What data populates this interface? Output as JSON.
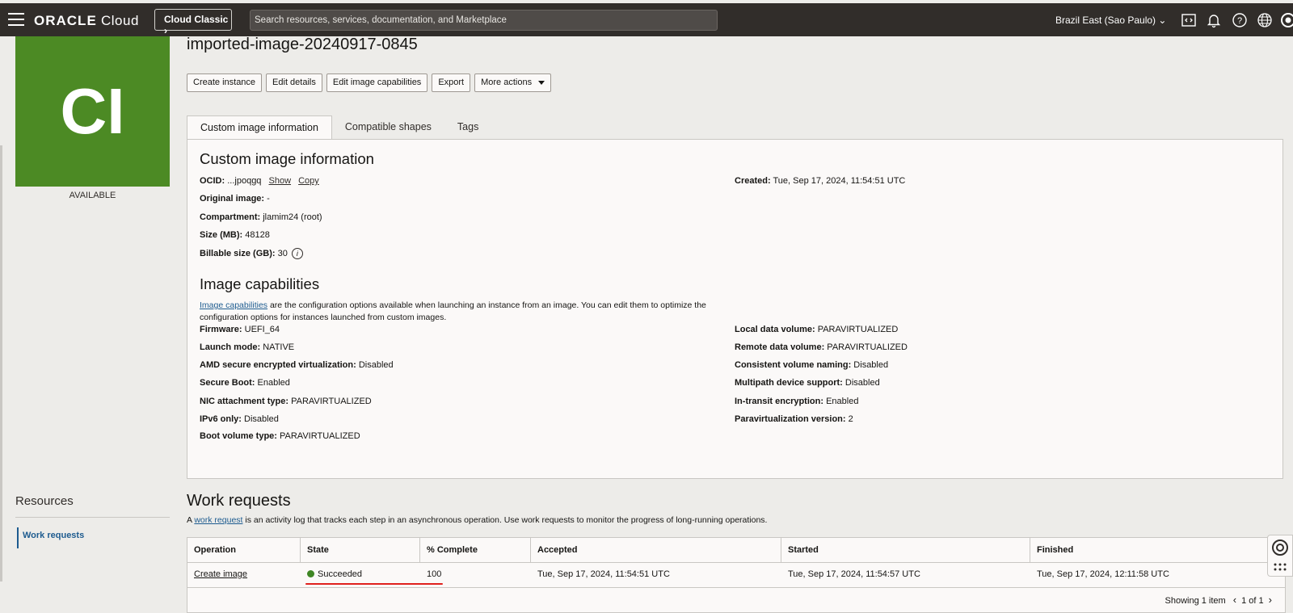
{
  "header": {
    "brand_bold": "ORACLE",
    "brand_rest": " Cloud",
    "classic_button": "Cloud Classic ",
    "search_placeholder": "Search resources, services, documentation, and Marketplace",
    "region": "Brazil East (Sao Paulo)"
  },
  "sidebar": {
    "tile_text": "CI",
    "tile_color": "#4c8a24",
    "status": "AVAILABLE",
    "resources_title": "Resources",
    "resources_items": [
      "Work requests"
    ]
  },
  "page": {
    "title": "imported-image-20240917-0845",
    "actions": [
      "Create instance",
      "Edit details",
      "Edit image capabilities",
      "Export",
      "More actions"
    ],
    "tabs": [
      "Custom image information",
      "Compatible shapes",
      "Tags"
    ]
  },
  "info": {
    "heading": "Custom image information",
    "ocid_label": "OCID:",
    "ocid_value": " ...jpoqgq",
    "show": "Show",
    "copy": "Copy",
    "original_image_label": "Original image:",
    "original_image_value": " -",
    "compartment_label": "Compartment:",
    "compartment_value": " jlamim24 (root)",
    "size_label": "Size (MB):",
    "size_value": " 48128",
    "billable_label": "Billable size (GB):",
    "billable_value": " 30",
    "created_label": "Created:",
    "created_value": " Tue, Sep 17, 2024, 11:54:51 UTC"
  },
  "capabilities": {
    "heading": "Image capabilities",
    "link_text": "Image capabilities",
    "description": " are the configuration options available when launching an instance from an image. You can edit them to optimize the configuration options for instances launched from custom images.",
    "left": [
      {
        "label": "Firmware:",
        "value": " UEFI_64"
      },
      {
        "label": "Launch mode:",
        "value": " NATIVE"
      },
      {
        "label": "AMD secure encrypted virtualization:",
        "value": " Disabled"
      },
      {
        "label": "Secure Boot:",
        "value": " Enabled"
      },
      {
        "label": "NIC attachment type:",
        "value": " PARAVIRTUALIZED"
      },
      {
        "label": "IPv6 only:",
        "value": " Disabled"
      },
      {
        "label": "Boot volume type:",
        "value": " PARAVIRTUALIZED"
      }
    ],
    "right": [
      {
        "label": "Local data volume:",
        "value": " PARAVIRTUALIZED"
      },
      {
        "label": "Remote data volume:",
        "value": " PARAVIRTUALIZED"
      },
      {
        "label": "Consistent volume naming:",
        "value": " Disabled"
      },
      {
        "label": "Multipath device support:",
        "value": " Disabled"
      },
      {
        "label": "In-transit encryption:",
        "value": " Enabled"
      },
      {
        "label": "Paravirtualization version:",
        "value": " 2"
      }
    ]
  },
  "work_requests": {
    "title": "Work requests",
    "desc_prefix": "A ",
    "desc_link": "work request",
    "desc_suffix": " is an activity log that tracks each step in an asynchronous operation. Use work requests to monitor the progress of long-running operations.",
    "columns": [
      "Operation",
      "State",
      "% Complete",
      "Accepted",
      "Started",
      "Finished"
    ],
    "rows": [
      {
        "operation": "Create image",
        "state": "Succeeded",
        "state_color": "#3f8624",
        "percent_complete": "100",
        "accepted": "Tue, Sep 17, 2024, 11:54:51 UTC",
        "started": "Tue, Sep 17, 2024, 11:54:57 UTC",
        "finished": "Tue, Sep 17, 2024, 12:11:58 UTC"
      }
    ],
    "showing": "Showing 1 item",
    "page": "1 of 1"
  },
  "colors": {
    "header_bg": "#312d2a",
    "link": "#1d5b8f",
    "highlight_underline": "#e0211d"
  }
}
